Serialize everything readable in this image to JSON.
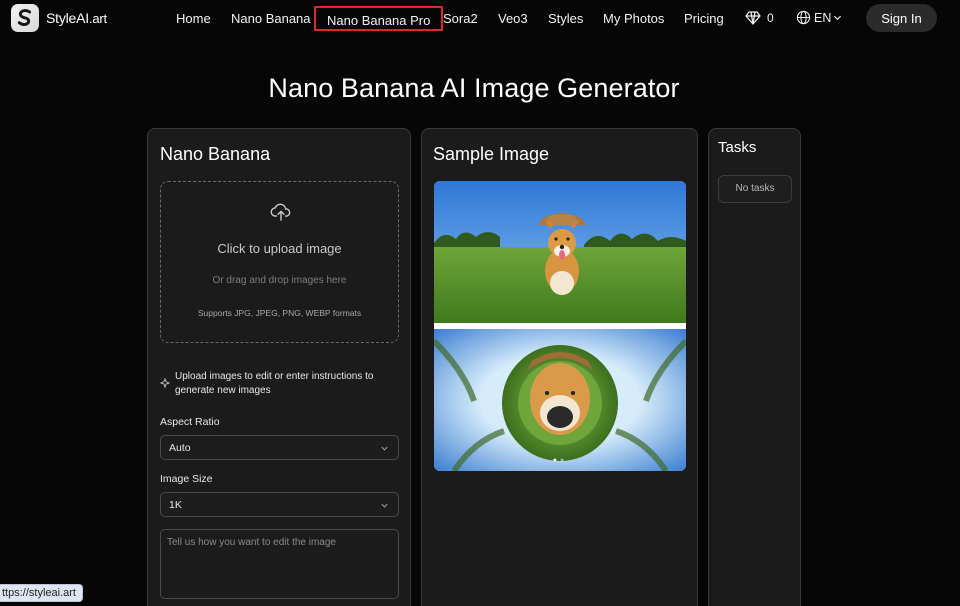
{
  "brand": {
    "name": "StyleAI",
    "suffix": ".art"
  },
  "nav": {
    "links": [
      "Home",
      "Nano Banana",
      "Nano Banana Pro",
      "Sora2",
      "Veo3",
      "Styles",
      "My Photos",
      "Pricing"
    ],
    "credits": "0",
    "language": "EN",
    "sign_in": "Sign In"
  },
  "page_title": "Nano Banana AI Image Generator",
  "left_panel": {
    "title": "Nano Banana",
    "upload": {
      "title": "Click to upload image",
      "subtitle": "Or drag and drop images here",
      "formats": "Supports JPG, JPEG, PNG, WEBP formats"
    },
    "hint": "Upload images to edit or enter instructions to generate new images",
    "aspect_ratio": {
      "label": "Aspect Ratio",
      "value": "Auto"
    },
    "image_size": {
      "label": "Image Size",
      "value": "1K"
    },
    "prompt_placeholder": "Tell us how you want to edit the image"
  },
  "mid_panel": {
    "title": "Sample Image"
  },
  "right_panel": {
    "title": "Tasks",
    "empty": "No tasks"
  },
  "status_url": "ttps://styleai.art",
  "colors": {
    "background": "#060606",
    "panel": "#1b1b1b",
    "active_outline": "#e0262b",
    "sign_in_bg": "#2b2b2b"
  }
}
